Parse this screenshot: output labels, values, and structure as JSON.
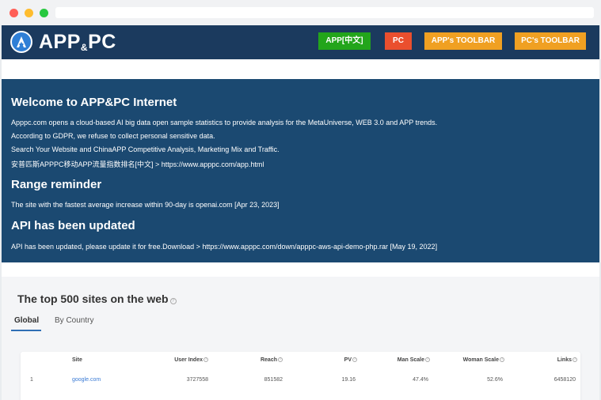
{
  "header": {
    "logo_text_a": "APP",
    "logo_text_amp": "&",
    "logo_text_b": "PC",
    "nav": {
      "app": "APP[中文]",
      "pc": "PC",
      "app_toolbar": "APP's TOOLBAR",
      "pc_toolbar": "PC's TOOLBAR"
    },
    "colors": {
      "bar": "#1b3a5e",
      "app": "#23a51b",
      "pc": "#ea4f2e",
      "toolbar": "#f0a022"
    }
  },
  "notice": {
    "welcome_title": "Welcome to APP&PC Internet",
    "lines": [
      "Apppc.com opens a cloud-based AI big data open sample statistics to provide analysis for the MetaUniverse, WEB 3.0 and APP trends.",
      "According to GDPR, we refuse to collect personal sensitive data.",
      "Search Your Website and ChinaAPP Competitive Analysis, Marketing Mix and Traffic.",
      "安普匹斯APPPC移动APP流量指数排名[中文] > https://www.apppc.com/app.html"
    ],
    "range_title": "Range reminder",
    "range_text": "The site with the fastest average increase within 90-day is openai.com [Apr 23, 2023]",
    "api_title": "API has been updated",
    "api_text": "API has been updated, please update it for free.Download > https://www.apppc.com/down/apppc-aws-api-demo-php.rar [May 19, 2022]"
  },
  "ranking": {
    "title": "The top 500 sites on the web",
    "help_glyph": "?",
    "tabs": [
      "Global",
      "By Country"
    ],
    "active_tab": "Global",
    "columns": [
      "Site",
      "User Index",
      "Reach",
      "PV",
      "Man Scale",
      "Woman Scale",
      "Links"
    ],
    "rows": [
      [
        "1",
        "google.com",
        "3727558",
        "851582",
        "19.16",
        "47.4%",
        "52.6%",
        "6458120"
      ]
    ]
  }
}
